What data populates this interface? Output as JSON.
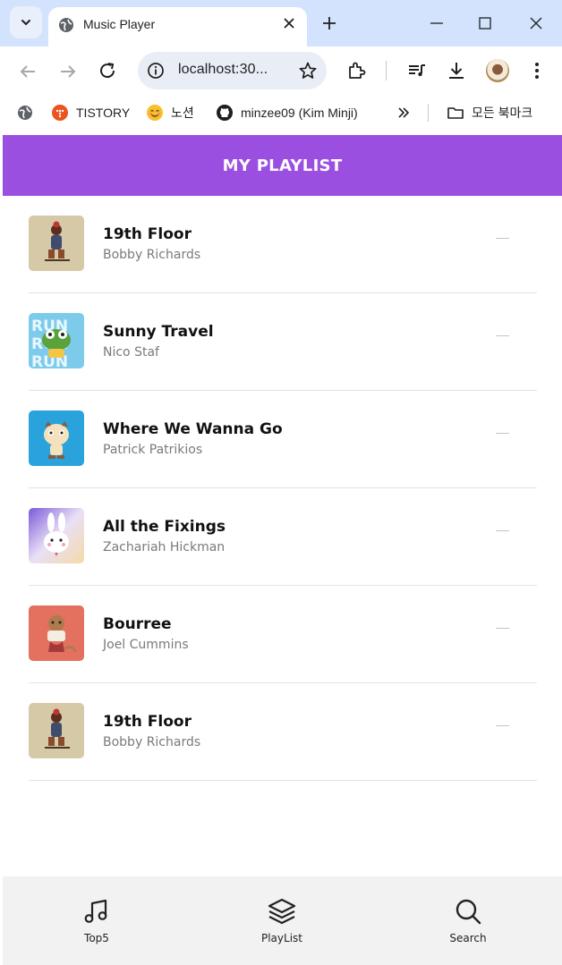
{
  "browser": {
    "tab_title": "Music Player",
    "url": "localhost:30...",
    "bookmarks": [
      {
        "label": "",
        "icon": "globe-icon"
      },
      {
        "label": "TISTORY",
        "icon": "tistory-icon"
      },
      {
        "label": "노션",
        "icon": "notion-emoji-icon"
      },
      {
        "label": "minzee09 (Kim Minji)",
        "icon": "github-icon"
      },
      {
        "label": "",
        "icon": "chevron-double-right-icon"
      },
      {
        "label": "모든 북마크",
        "icon": "folder-icon"
      }
    ]
  },
  "app": {
    "title": "MY PLAYLIST",
    "tracks": [
      {
        "title": "19th Floor",
        "artist": "Bobby Richards",
        "art": "khaki-character"
      },
      {
        "title": "Sunny Travel",
        "artist": "Nico Staf",
        "art": "run-frog"
      },
      {
        "title": "Where We Wanna Go",
        "artist": "Patrick Patrikios",
        "art": "blue-squirrel"
      },
      {
        "title": "All the Fixings",
        "artist": "Zachariah Hickman",
        "art": "purple-bunny"
      },
      {
        "title": "Bourree",
        "artist": "Joel Cummins",
        "art": "red-otter"
      },
      {
        "title": "19th Floor",
        "artist": "Bobby Richards",
        "art": "khaki-character"
      }
    ],
    "nav": [
      {
        "label": "Top5",
        "icon": "music-note-icon"
      },
      {
        "label": "PlayList",
        "icon": "layers-icon"
      },
      {
        "label": "Search",
        "icon": "search-icon"
      }
    ]
  },
  "colors": {
    "header": "#9b4fe0",
    "chrome": "#d3e3fd",
    "nav_bg": "#f2f2f2"
  }
}
